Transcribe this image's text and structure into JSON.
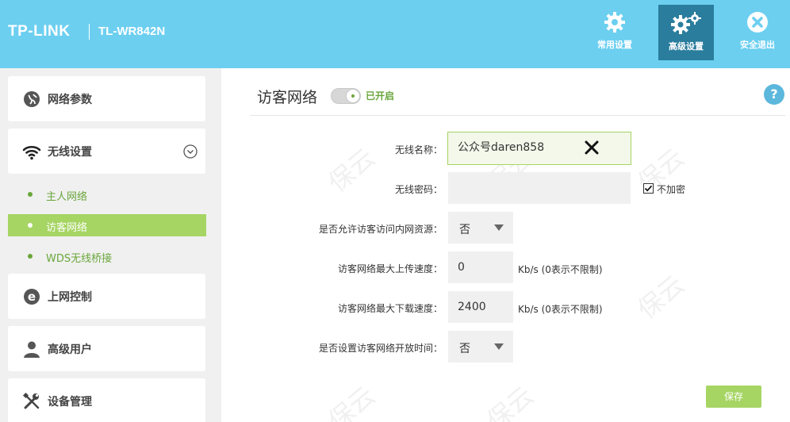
{
  "header": {
    "logo": "TP-LINK",
    "model": "TL-WR842N",
    "buttons": [
      {
        "label": "常用设置",
        "icon": "gear-icon"
      },
      {
        "label": "高级设置",
        "icon": "gears-icon"
      },
      {
        "label": "安全退出",
        "icon": "exit-icon"
      }
    ]
  },
  "sidebar": {
    "menu": [
      {
        "label": "网络参数",
        "icon": "network-icon"
      },
      {
        "label": "无线设置",
        "icon": "wifi-icon"
      },
      {
        "label": "上网控制",
        "icon": "ie-icon"
      },
      {
        "label": "高级用户",
        "icon": "user-icon"
      },
      {
        "label": "设备管理",
        "icon": "tools-icon"
      }
    ],
    "subitems": [
      {
        "label": "主人网络"
      },
      {
        "label": "访客网络"
      },
      {
        "label": "WDS无线桥接"
      }
    ]
  },
  "main": {
    "title": "访客网络",
    "toggle_label": "已开启",
    "help": "?",
    "fields": {
      "ssid_label": "无线名称：",
      "ssid_value": "公众号daren858",
      "password_label": "无线密码：",
      "password_value": "",
      "no_encrypt_label": "不加密",
      "allow_internal_label": "是否允许访客访问内网资源：",
      "allow_internal_value": "否",
      "upload_label": "访客网络最大上传速度：",
      "upload_value": "0",
      "upload_unit": "Kb/s (0表示不限制)",
      "download_label": "访客网络最大下载速度：",
      "download_value": "2400",
      "download_unit": "Kb/s (0表示不限制)",
      "schedule_label": "是否设置访客网络开放时间：",
      "schedule_value": "否"
    },
    "save_label": "保存"
  },
  "colors": {
    "header_bg": "#6ccff0",
    "active_header_btn": "#2a7d9d",
    "accent_green": "#a6d563",
    "text_green": "#6aa63b"
  }
}
